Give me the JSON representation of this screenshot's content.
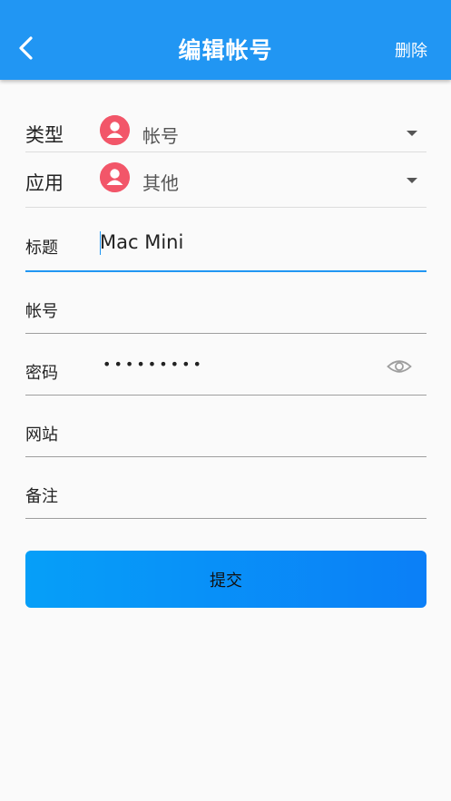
{
  "appbar": {
    "title": "编辑帐号",
    "delete_label": "删除",
    "color": "#2196f3"
  },
  "form": {
    "type": {
      "label": "类型",
      "value": "帐号"
    },
    "app": {
      "label": "应用",
      "value": "其他"
    },
    "title_field": {
      "label": "标题",
      "value": "Mac Mini"
    },
    "account": {
      "label": "帐号",
      "value": ""
    },
    "password": {
      "label": "密码",
      "masked": "•••••••••"
    },
    "website": {
      "label": "网站",
      "value": ""
    },
    "note": {
      "label": "备注",
      "value": ""
    }
  },
  "submit_label": "提交",
  "colors": {
    "avatar": "#f25669",
    "accent": "#2196f3",
    "button": "#0b8ff7"
  }
}
